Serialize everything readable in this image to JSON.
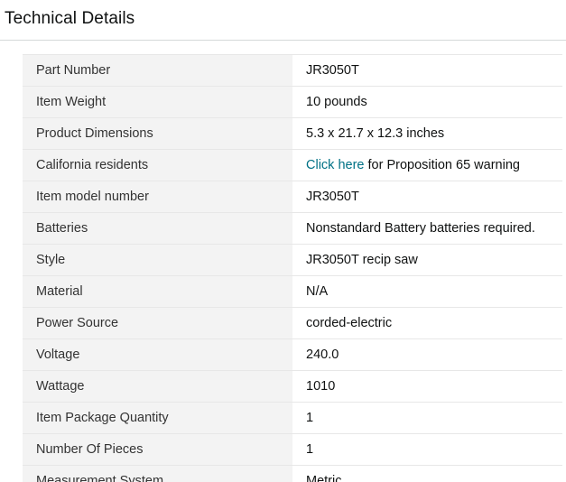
{
  "section": {
    "title": "Technical Details"
  },
  "colors": {
    "label_background": "#f3f3f3",
    "link": "#007185",
    "row_border": "#e7e7e7"
  },
  "rows": [
    {
      "label": "Part Number",
      "value": "JR3050T"
    },
    {
      "label": "Item Weight",
      "value": "10 pounds"
    },
    {
      "label": "Product Dimensions",
      "value": "5.3 x 21.7 x 12.3 inches"
    },
    {
      "label": "California residents",
      "link_text": "Click here",
      "value": " for Proposition 65 warning"
    },
    {
      "label": "Item model number",
      "value": "JR3050T"
    },
    {
      "label": "Batteries",
      "value": "Nonstandard Battery batteries required."
    },
    {
      "label": "Style",
      "value": "JR3050T recip saw"
    },
    {
      "label": "Material",
      "value": "N/A"
    },
    {
      "label": "Power Source",
      "value": "corded-electric"
    },
    {
      "label": "Voltage",
      "value": "240.0"
    },
    {
      "label": "Wattage",
      "value": "1010"
    },
    {
      "label": "Item Package Quantity",
      "value": "1"
    },
    {
      "label": "Number Of Pieces",
      "value": "1"
    },
    {
      "label": "Measurement System",
      "value": "Metric"
    }
  ]
}
